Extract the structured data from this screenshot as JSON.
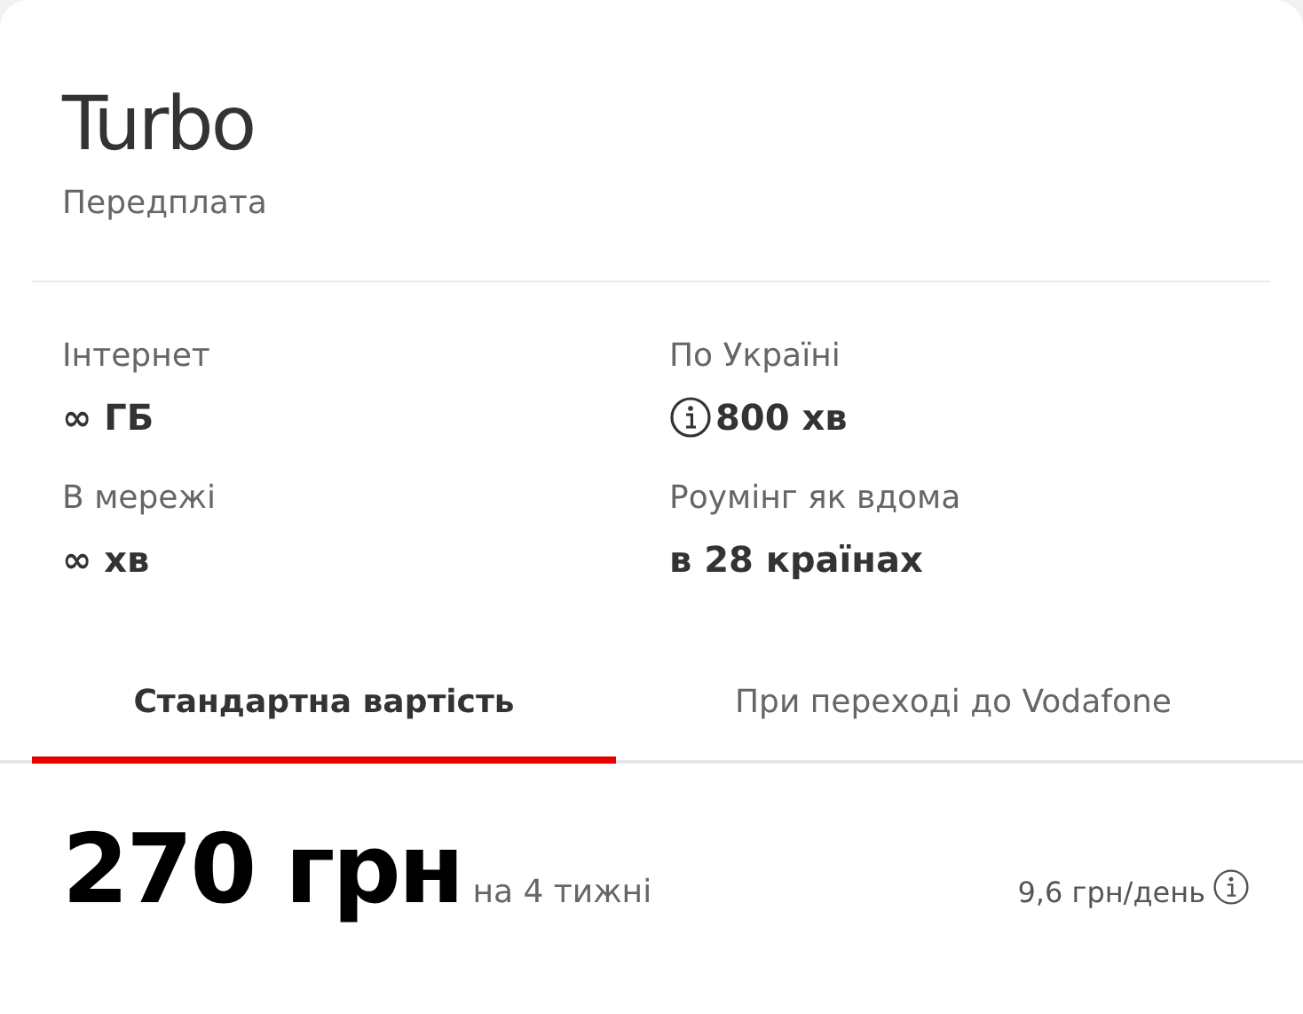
{
  "plan": {
    "title": "Turbo",
    "subtitle": "Передплата"
  },
  "features": [
    {
      "label": "Інтернет",
      "value": "∞ ГБ",
      "info": false
    },
    {
      "label": "По Україні",
      "value": "800 хв",
      "info": true
    },
    {
      "label": "В мережі",
      "value": "∞ хв",
      "info": false
    },
    {
      "label": "Роумінг як вдома",
      "value": "в 28 країнах",
      "info": false
    }
  ],
  "tabs": [
    {
      "label": "Стандартна вартість",
      "selected": true
    },
    {
      "label": "При переході до Vodafone",
      "selected": false
    }
  ],
  "price": {
    "amount": "270 грн",
    "period": "на 4 тижні",
    "per_day": "9,6 грн/день"
  }
}
